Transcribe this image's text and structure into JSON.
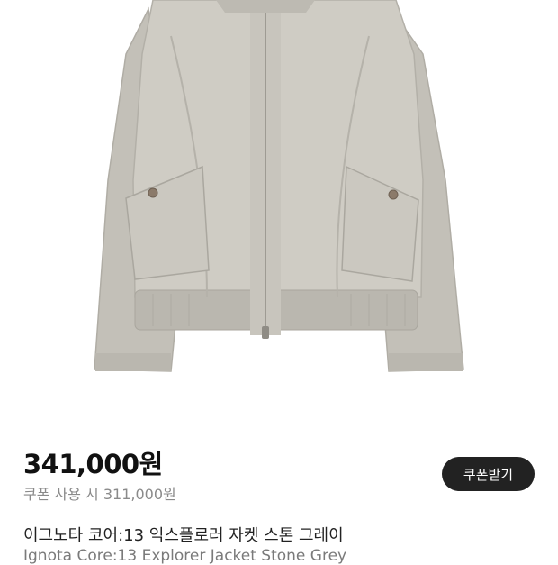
{
  "product": {
    "price": "341,000원",
    "coupon_price_text": "쿠폰 사용 시 311,000원",
    "coupon_button_label": "쿠폰받기",
    "title_ko": "이그노타 코어:13 익스플로러 자켓 스톤 그레이",
    "title_en": "Ignota Core:13 Explorer Jacket Stone Grey"
  },
  "colors": {
    "jacket_body": "#cfccc4",
    "jacket_sleeve": "#c3c0b8",
    "rib_knit": "#b9b6ae",
    "button_bg": "#222222"
  }
}
